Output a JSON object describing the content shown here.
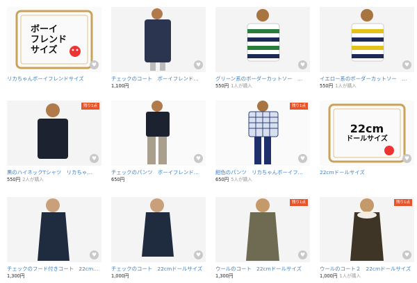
{
  "items": [
    {
      "title": "リカちゃんボーイフレンドサイズ",
      "price": "",
      "buyers": "",
      "badge": ""
    },
    {
      "title": "チェックのコート　ボーイフレンド…",
      "price": "1,100円",
      "buyers": "",
      "badge": ""
    },
    {
      "title": "グリーン系のボーダーカットソー　…",
      "price": "550円",
      "buyers": "1人が購入",
      "badge": ""
    },
    {
      "title": "イエロー系のボーダーカットソー　…",
      "price": "550円",
      "buyers": "1人が購入",
      "badge": ""
    },
    {
      "title": "黒のハイネックTシャツ　リカちゃ…",
      "price": "550円",
      "buyers": "2人が購入",
      "badge": "残り1点"
    },
    {
      "title": "チェックのパンツ　ボーイフレンド…",
      "price": "650円",
      "buyers": "",
      "badge": ""
    },
    {
      "title": "紺色のパンツ　リカちゃんボーイフ…",
      "price": "650円",
      "buyers": "5人が購入",
      "badge": "残り1点"
    },
    {
      "title": "22cmドールサイズ",
      "price": "",
      "buyers": "",
      "badge": ""
    },
    {
      "title": "チェックのフード付きコート　22cm…",
      "price": "1,300円",
      "buyers": "",
      "badge": ""
    },
    {
      "title": "チェックのコート　22cmドールサイズ",
      "price": "1,000円",
      "buyers": "",
      "badge": ""
    },
    {
      "title": "ウールのコート　22cmドールサイズ",
      "price": "1,300円",
      "buyers": "",
      "badge": "残り1点"
    },
    {
      "title": "ウールのコート２　22cmドールサイズ",
      "price": "1,000円",
      "buyers": "1人が購入",
      "badge": "残り1点"
    }
  ],
  "frame1": {
    "line1": "ボーイ",
    "line2": "フレンド",
    "line3": "サイズ"
  },
  "frame2": {
    "line1": "22cm",
    "line2": "ドールサイズ"
  },
  "icons": {
    "heart": "heart-icon"
  },
  "colors": {
    "link": "#3e7fc1",
    "badge": "#e8542a",
    "frame": "#c9a35a"
  }
}
